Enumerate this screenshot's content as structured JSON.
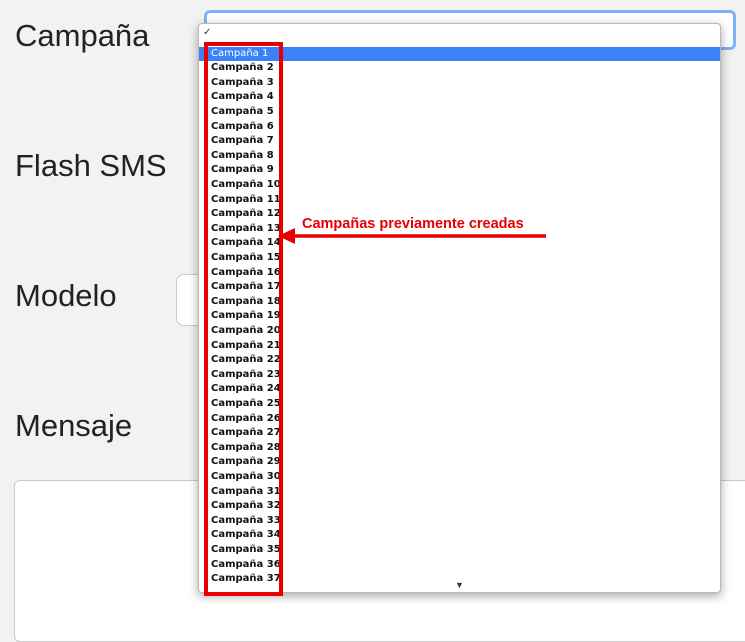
{
  "form": {
    "labels": {
      "campana": "Campaña",
      "flash_sms": "Flash SMS",
      "modelo": "Modelo",
      "mensaje": "Mensaje"
    }
  },
  "campaign_dropdown": {
    "check_mark": "✓",
    "selected": "Campaña 1",
    "options": [
      "Campaña 1",
      "Campaña 2",
      "Campaña 3",
      "Campaña 4",
      "Campaña 5",
      "Campaña 6",
      "Campaña 7",
      "Campaña 8",
      "Campaña 9",
      "Campaña 10",
      "Campaña 11",
      "Campaña 12",
      "Campaña 13",
      "Campaña 14",
      "Campaña 15",
      "Campaña 16",
      "Campaña 17",
      "Campaña 18",
      "Campaña 19",
      "Campaña 20",
      "Campaña 21",
      "Campaña 22",
      "Campaña 23",
      "Campaña 24",
      "Campaña 25",
      "Campaña 26",
      "Campaña 27",
      "Campaña 28",
      "Campaña 29",
      "Campaña 30",
      "Campaña 31",
      "Campaña 32",
      "Campaña 33",
      "Campaña 34",
      "Campaña 35",
      "Campaña 36",
      "Campaña 37"
    ],
    "scroll_down_icon": "triangle-down"
  },
  "annotation": {
    "text": "Campañas previamente creadas",
    "color": "#e60000"
  },
  "colors": {
    "highlight": "#3b82f6",
    "focus_ring": "#7fb1f5"
  }
}
